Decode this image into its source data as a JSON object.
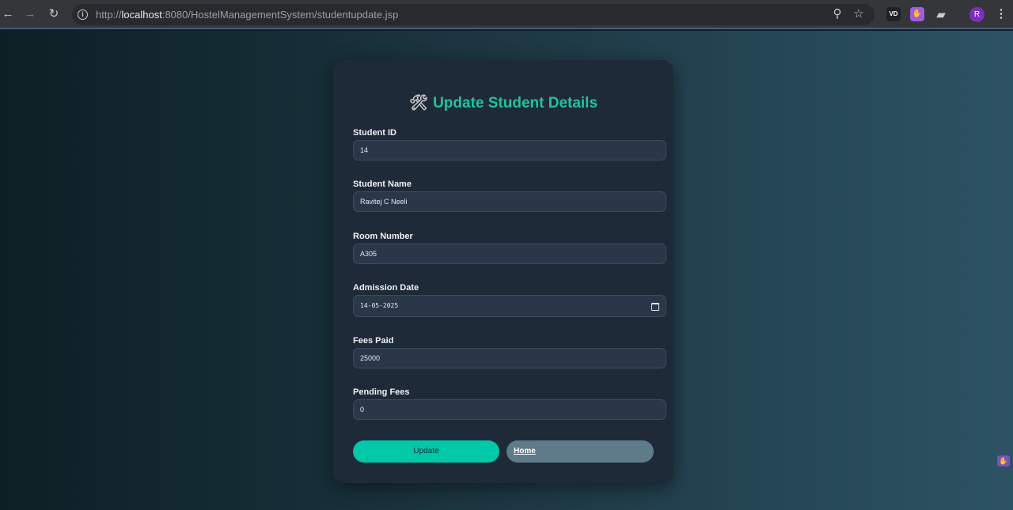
{
  "browser": {
    "url_prefix": "http://",
    "url_host": "localhost",
    "url_rest": ":8080/HostelManagementSystem/studentupdate.jsp",
    "avatar_letter": "R",
    "ext_vd_label": "VD"
  },
  "form": {
    "title": "Update Student Details",
    "title_icon": "🛠",
    "fields": [
      {
        "label": "Student ID",
        "value": "14"
      },
      {
        "label": "Student Name",
        "value": "Ravitej C Neeli"
      },
      {
        "label": "Room Number",
        "value": "A305"
      },
      {
        "label": "Admission Date",
        "value": "14-05-2025"
      },
      {
        "label": "Fees Paid",
        "value": "25000"
      },
      {
        "label": "Pending Fees",
        "value": "0"
      }
    ],
    "update_label": "Update",
    "home_label": "Home"
  },
  "colors": {
    "accent": "#1fc4a0",
    "update_button": "#00c8a8",
    "home_button": "#5f7a89",
    "card": "#1e2a38"
  }
}
